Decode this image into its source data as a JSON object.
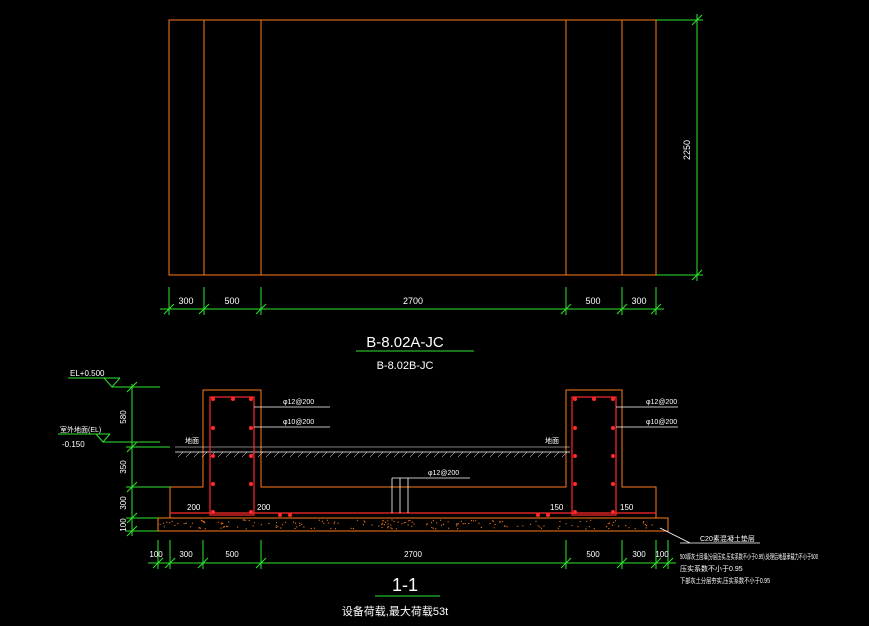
{
  "colors": {
    "background": "#000000",
    "outline": "#ff7a1a",
    "dimension": "#2ee62e",
    "text": "#ffffff",
    "rebar": "#ff2a2a",
    "leader": "#ffffff",
    "label_green": "#3cff3c"
  },
  "plan": {
    "width_dims": [
      "300",
      "500",
      "2700",
      "500",
      "300"
    ],
    "height_dim": "2250"
  },
  "titles": {
    "plan_title": "B-8.02A-JC",
    "plan_subtitle": "B-8.02B-JC",
    "section_title": "1-1",
    "section_note": "设备荷载,最大荷载53t"
  },
  "section": {
    "el_top": "EL+0.500",
    "el_ground_label": "室外地面(EL)",
    "el_ground": "-0.150",
    "ground_left": "地面",
    "ground_right": "地面",
    "vertical_dims": [
      "580",
      "350",
      "300",
      "100"
    ],
    "bottom_dims": [
      "100",
      "300",
      "500",
      "2700",
      "500",
      "300",
      "100"
    ],
    "left_rebar": [
      "φ12@200",
      "φ10@200"
    ],
    "right_rebar": [
      "φ12@200",
      "φ10@200"
    ],
    "slab_rebar": "φ12@200",
    "inner_dims": [
      "200",
      "200",
      "150",
      "150"
    ],
    "notes": [
      "C20素混凝土垫层",
      "500厚灰土回填(分层压实,压实系数不小于0.95),处理后地基承载力不小于500",
      "压实系数不小于0.95",
      "下部灰土分层夯实,压实系数不小于0.95"
    ]
  }
}
